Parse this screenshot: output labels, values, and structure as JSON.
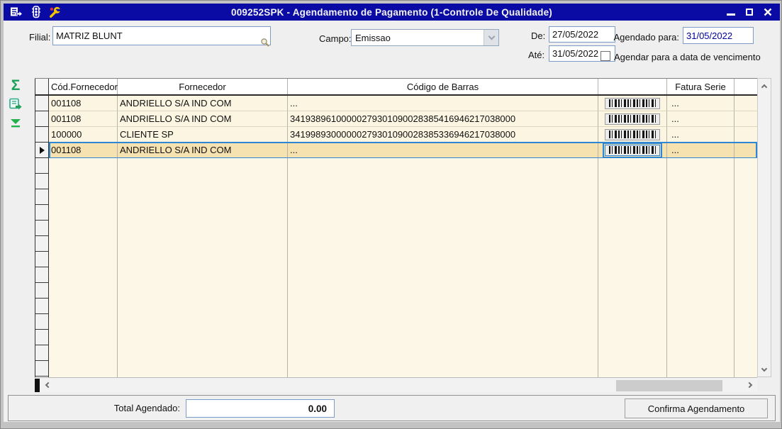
{
  "window": {
    "title": "009252SPK - Agendamento de Pagamento (1-Controle De Qualidade)"
  },
  "form": {
    "filial": {
      "label": "Filial:",
      "value": "MATRIZ BLUNT"
    },
    "campo": {
      "label": "Campo:",
      "value": "Emissao"
    },
    "de": {
      "label": "De:",
      "value": "27/05/2022"
    },
    "ate": {
      "label": "Até:",
      "value": "31/05/2022"
    },
    "agendado_para": {
      "label": "Agendado para:",
      "value": "31/05/2022"
    },
    "vencimento_checkbox": {
      "label": "Agendar para a data de vencimento",
      "checked": false
    }
  },
  "toolbar": {
    "sum_glyph": "Σ"
  },
  "grid": {
    "headers": {
      "cod": "Cód.Fornecedor",
      "fornecedor": "Fornecedor",
      "codigo_barras": "Código de Barras",
      "barcode_img": "",
      "fatura_serie": "Fatura Serie"
    },
    "rows": [
      {
        "cod": "001108",
        "fornecedor": "ANDRIELLO S/A IND COM",
        "codigo_barras": "...",
        "fatura_serie": "...",
        "selected": false
      },
      {
        "cod": "001108",
        "fornecedor": "ANDRIELLO S/A IND COM",
        "codigo_barras": "34193896100000279301090028385416946217038000",
        "fatura_serie": "...",
        "selected": false
      },
      {
        "cod": "100000",
        "fornecedor": "CLIENTE SP",
        "codigo_barras": "34199893000000279301090028385336946217038000",
        "fatura_serie": "...",
        "selected": false
      },
      {
        "cod": "001108",
        "fornecedor": "ANDRIELLO S/A IND COM",
        "codigo_barras": "...",
        "fatura_serie": "...",
        "selected": true
      }
    ]
  },
  "footer": {
    "total_label": "Total Agendado:",
    "total_value": "0.00",
    "confirm_label": "Confirma Agendamento"
  },
  "colors": {
    "titlebar": "#0A0AA5",
    "row_bg": "#FBF5E1",
    "selected_row_bg": "#F6E1B0",
    "selection_border": "#2F86D2",
    "icon_green": "#1FA05A",
    "agendado_value_text": "#00009B"
  }
}
